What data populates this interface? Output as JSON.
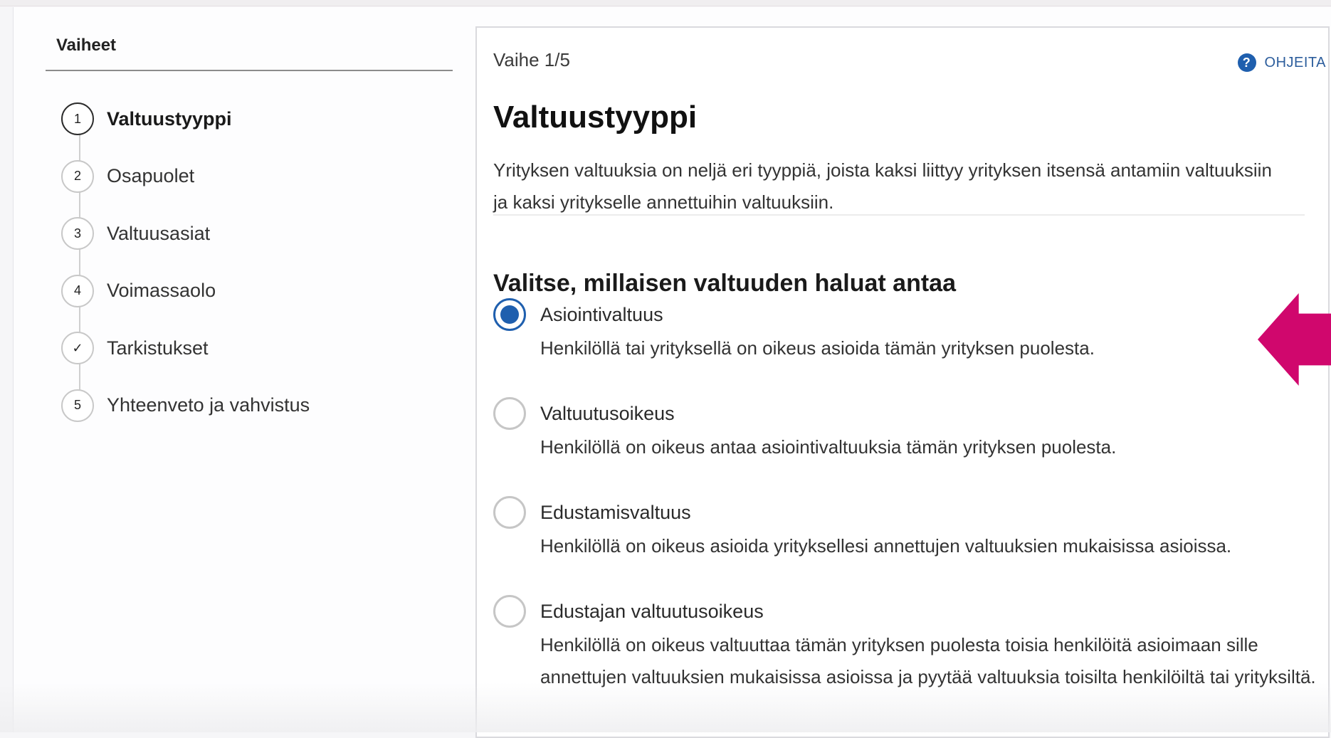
{
  "sidebar": {
    "title": "Vaiheet",
    "steps": [
      {
        "num": "1",
        "label": "Valtuustyyppi",
        "active": true
      },
      {
        "num": "2",
        "label": "Osapuolet"
      },
      {
        "num": "3",
        "label": "Valtuusasiat"
      },
      {
        "num": "4",
        "label": "Voimassaolo"
      },
      {
        "num": "✓",
        "label": "Tarkistukset"
      },
      {
        "num": "5",
        "label": "Yhteenveto ja vahvistus"
      }
    ]
  },
  "main": {
    "step_counter": "Vaihe 1/5",
    "help_label": "OHJEITA",
    "help_icon_glyph": "?",
    "title": "Valtuustyyppi",
    "intro": "Yrityksen valtuuksia on neljä eri tyyppiä, joista kaksi liittyy yrityksen itsensä antamiin valtuuksiin ja kaksi yritykselle annettuihin valtuuksiin.",
    "section_title": "Valitse, millaisen valtuuden haluat antaa",
    "options": [
      {
        "label": "Asiointivaltuus",
        "desc": "Henkilöllä tai yrityksellä on oikeus asioida tämän yrityksen puolesta.",
        "selected": true
      },
      {
        "label": "Valtuutusoikeus",
        "desc": "Henkilöllä on oikeus antaa asiointivaltuuksia tämän yrityksen puolesta.",
        "selected": false
      },
      {
        "label": "Edustamisvaltuus",
        "desc": "Henkilöllä on oikeus asioida yrityksellesi annettujen valtuuksien mukaisissa asioissa.",
        "selected": false
      },
      {
        "label": "Edustajan valtuutusoikeus",
        "desc": "Henkilöllä on oikeus valtuuttaa tämän yrityksen puolesta toisia henkilöitä asioimaan sille annettujen valtuuksien mukaisissa asioissa ja pyytää valtuuksia toisilta henkilöiltä tai yrityksiltä.",
        "selected": false
      }
    ]
  },
  "colors": {
    "accent": "#1f5fae",
    "pointer_arrow": "#d0076d"
  }
}
